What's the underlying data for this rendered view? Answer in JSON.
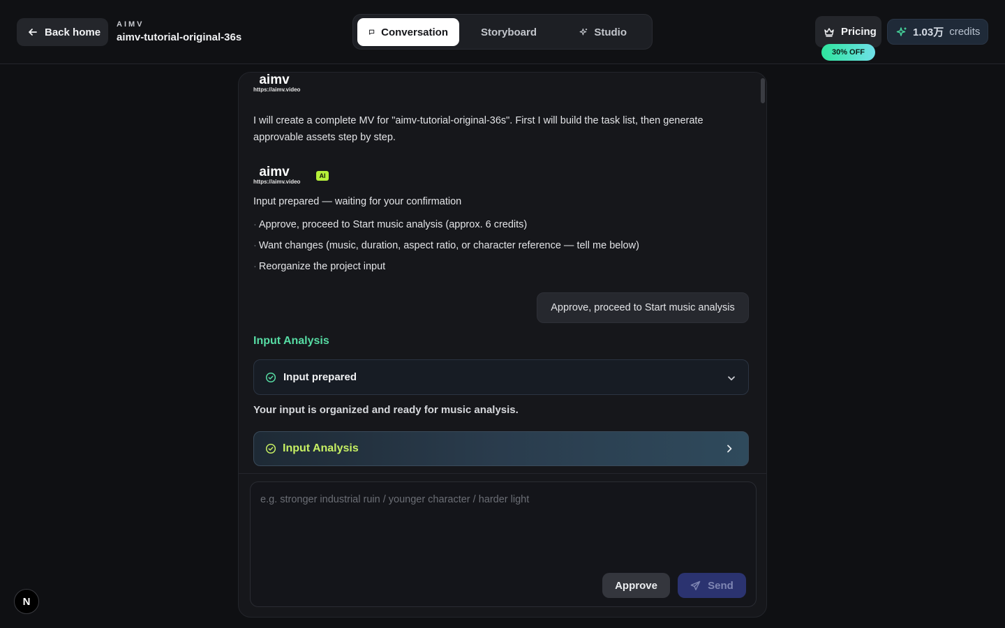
{
  "header": {
    "back_label": "Back home",
    "brand": "AIMV",
    "project_name": "aimv-tutorial-original-36s",
    "tabs": [
      {
        "label": "Conversation",
        "icon": "chat-bubble-icon",
        "active": true
      },
      {
        "label": "Storyboard",
        "icon": "grid-icon",
        "active": false
      },
      {
        "label": "Studio",
        "icon": "sparkle-icon",
        "active": false
      }
    ],
    "pricing_label": "Pricing",
    "discount_badge": "30% OFF",
    "credits_value": "1.03万",
    "credits_label": "credits"
  },
  "chat": {
    "logo_word": "aimv",
    "logo_url": "https://aimv.video",
    "ai_badge": "AI",
    "intro": "I will create a complete MV for \"aimv-tutorial-original-36s\". First I will build the task list, then generate approvable assets step by step.",
    "status": "Input prepared — waiting for your confirmation",
    "options": [
      "Approve, proceed to Start music analysis (approx. 6 credits)",
      "Want changes (music, duration, aspect ratio, or character reference — tell me below)",
      "Reorganize the project input"
    ],
    "user_reply": "Approve, proceed to Start music analysis",
    "section_title": "Input Analysis",
    "step_title": "Input prepared",
    "step_desc": "Your input is organized and ready for music analysis.",
    "analysis_card": "Input Analysis"
  },
  "composer": {
    "placeholder": "e.g. stronger industrial ruin / younger character / harder light",
    "approve_label": "Approve",
    "send_label": "Send"
  },
  "colors": {
    "accent_green": "#57dca4",
    "accent_lime": "#c7f063",
    "send_blue": "#2b3370"
  },
  "floating_badge": "N"
}
